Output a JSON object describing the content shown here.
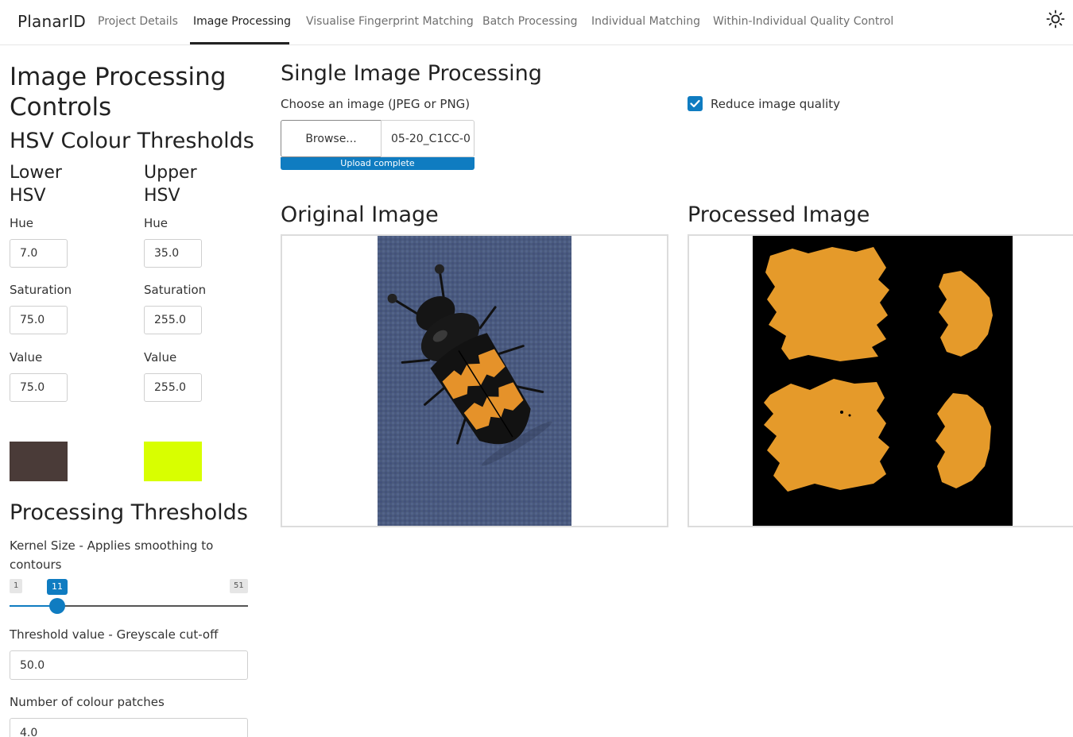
{
  "navbar": {
    "brand": "PlanarID",
    "tabs": [
      {
        "label": "Project Details",
        "active": false
      },
      {
        "label": "Image Processing",
        "active": true
      },
      {
        "label": "Visualise Fingerprint Matching",
        "active": false
      },
      {
        "label": "Batch Processing",
        "active": false
      },
      {
        "label": "Individual Matching",
        "active": false
      },
      {
        "label": "Within-Individual Quality Control",
        "active": false
      }
    ],
    "theme_icon": "sun-icon"
  },
  "sidebar": {
    "title": "Image Processing Controls",
    "hsv_heading": "HSV Colour Thresholds",
    "lower": {
      "heading": "Lower HSV",
      "hue_label": "Hue",
      "hue": "7.0",
      "sat_label": "Saturation",
      "sat": "75.0",
      "val_label": "Value",
      "val": "75.0",
      "swatch_color": "#4a3b38"
    },
    "upper": {
      "heading": "Upper HSV",
      "hue_label": "Hue",
      "hue": "35.0",
      "sat_label": "Saturation",
      "sat": "255.0",
      "val_label": "Value",
      "val": "255.0",
      "swatch_color": "#d8ff00"
    },
    "proc_heading": "Processing Thresholds",
    "kernel": {
      "label": "Kernel Size - Applies smoothing to contours",
      "min": "1",
      "max": "51",
      "value": "11",
      "fraction": 0.2
    },
    "threshold": {
      "label": "Threshold value - Greyscale cut-off",
      "value": "50.0"
    },
    "patches": {
      "label": "Number of colour patches",
      "value": "4.0"
    }
  },
  "main": {
    "title": "Single Image Processing",
    "file_label": "Choose an image (JPEG or PNG)",
    "browse_label": "Browse...",
    "file_name": "05-20_C1CC-0",
    "progress_label": "Upload complete",
    "reduce_label": "Reduce image quality",
    "reduce_checked": true,
    "original_title": "Original Image",
    "processed_title": "Processed Image"
  },
  "colors": {
    "accent": "#0f7cc1",
    "beetle_bg": "#48587b",
    "orange": "#e59a26"
  }
}
